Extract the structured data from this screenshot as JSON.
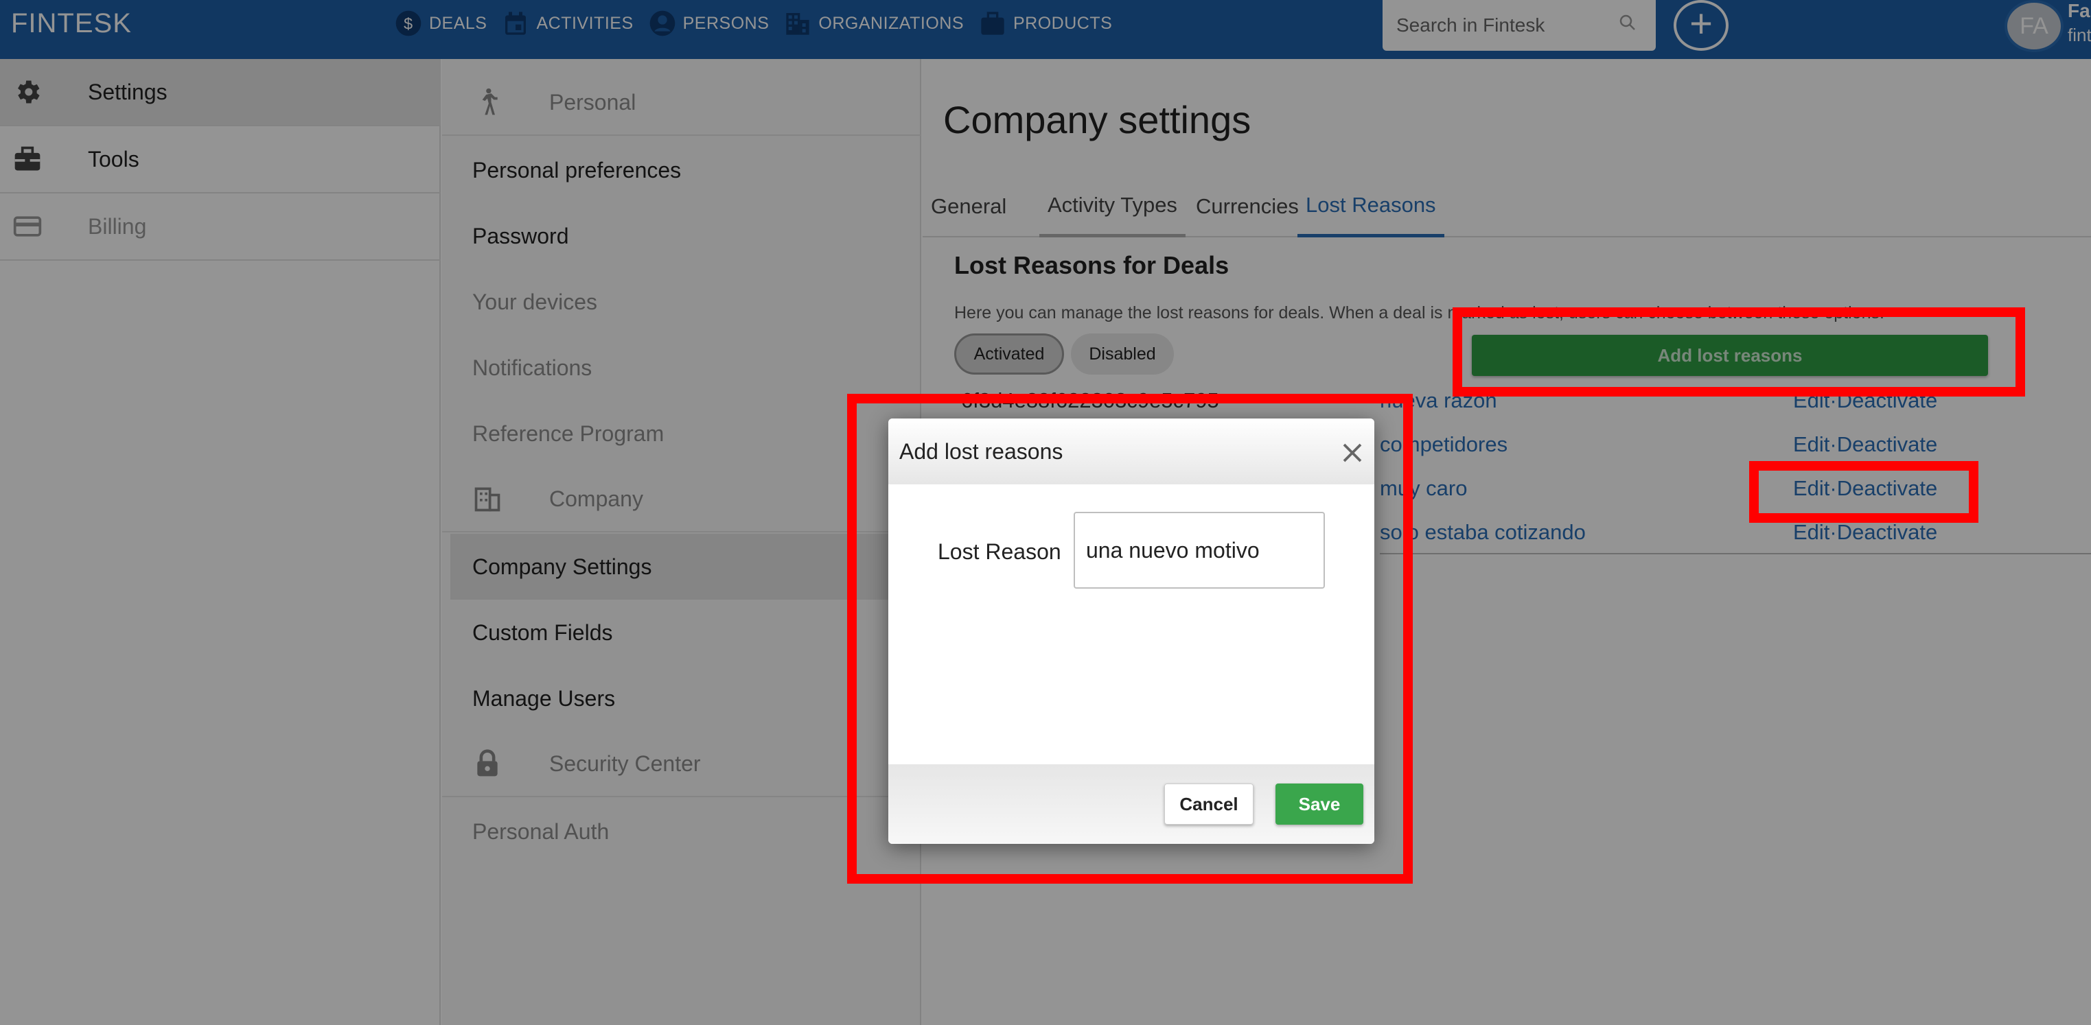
{
  "app": {
    "brand": "FINTESK",
    "nav": [
      {
        "label": "DEALS",
        "icon": "dollar-circle-icon"
      },
      {
        "label": "ACTIVITIES",
        "icon": "calendar-icon"
      },
      {
        "label": "PERSONS",
        "icon": "person-circle-icon"
      },
      {
        "label": "ORGANIZATIONS",
        "icon": "building-icon"
      },
      {
        "label": "PRODUCTS",
        "icon": "briefcase-icon"
      }
    ],
    "search_placeholder": "Search in Fintesk",
    "user": {
      "initials": "FA",
      "name": "Fa",
      "sub": "fint"
    }
  },
  "sidebar": {
    "items": [
      {
        "label": "Settings",
        "icon": "gear-icon"
      },
      {
        "label": "Tools",
        "icon": "toolbox-icon"
      },
      {
        "label": "Billing",
        "icon": "credit-card-icon"
      }
    ]
  },
  "menu": {
    "personal_section": "Personal",
    "personal_items": [
      "Personal preferences",
      "Password",
      "Your devices",
      "Notifications",
      "Reference Program"
    ],
    "company_section": "Company",
    "company_items": [
      "Company Settings",
      "Custom Fields",
      "Manage Users"
    ],
    "security_section": "Security Center",
    "security_items": [
      "Personal Auth"
    ]
  },
  "main": {
    "title": "Company settings",
    "tabs": [
      "General",
      "Activity Types",
      "Currencies",
      "Lost Reasons"
    ],
    "active_tab": "Lost Reasons",
    "section_title": "Lost Reasons for Deals",
    "section_desc": "Here you can manage the lost reasons for deals. When a deal is marked as lost, users can choose between these options.",
    "filters": [
      "Activated",
      "Disabled"
    ],
    "add_button": "Add lost reasons",
    "rows": [
      {
        "id": "6f3d4e88f622303c9e5c795",
        "name": "nueva razon",
        "edit": "Edit",
        "sep": "·",
        "deactivate": "Deactivate"
      },
      {
        "id": "",
        "name": "competidores",
        "edit": "Edit",
        "sep": "·",
        "deactivate": "Deactivate"
      },
      {
        "id": "",
        "name": "muy caro",
        "edit": "Edit",
        "sep": "·",
        "deactivate": "Deactivate"
      },
      {
        "id": "",
        "name": "solo estaba cotizando",
        "edit": "Edit",
        "sep": "·",
        "deactivate": "Deactivate"
      }
    ]
  },
  "modal": {
    "title": "Add lost reasons",
    "field_label": "Lost Reason",
    "field_value": "una nuevo motivo",
    "cancel": "Cancel",
    "save": "Save"
  },
  "colors": {
    "topbar": "#1e5fa8",
    "accent": "#2a6db5",
    "save_green": "#3aa64c",
    "highlight": "#ff0000"
  }
}
